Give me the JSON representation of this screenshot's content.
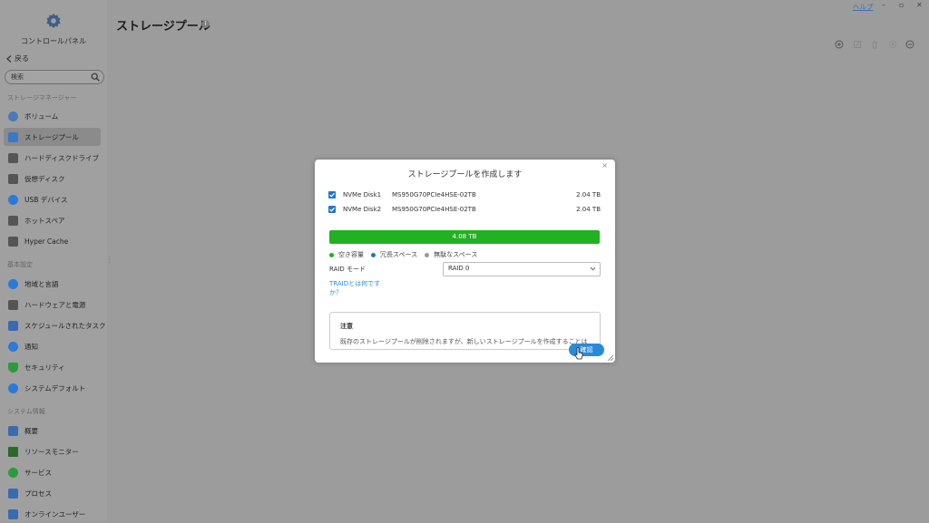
{
  "header": {
    "control_panel_label": "コントロールパネル",
    "title": "ストレージプール",
    "info_icon": "info-icon",
    "help": "ヘルプ",
    "window_controls": [
      "–",
      "▫",
      "✕"
    ]
  },
  "sidebar": {
    "back": "戻る",
    "search_placeholder": "検索",
    "sections": [
      {
        "title": "ストレージマネージャー",
        "items": [
          {
            "label": "ボリューム",
            "icon": "volume-icon",
            "color": "#4a7ab8"
          },
          {
            "label": "ストレージプール",
            "icon": "storage-pool-icon",
            "color": "#3a78c8",
            "active": true
          },
          {
            "label": "ハードディスクドライブ",
            "icon": "hdd-icon",
            "color": "#555555"
          },
          {
            "label": "仮想ディスク",
            "icon": "virtual-disk-icon",
            "color": "#555555"
          },
          {
            "label": "USB デバイス",
            "icon": "usb-icon",
            "color": "#2a7ad8"
          },
          {
            "label": "ホットスペア",
            "icon": "hot-spare-icon",
            "color": "#555555"
          },
          {
            "label": "Hyper Cache",
            "icon": "hyper-cache-icon",
            "color": "#555555"
          }
        ]
      },
      {
        "title": "基本設定",
        "items": [
          {
            "label": "地域と言語",
            "icon": "globe-icon",
            "color": "#2a7ad8"
          },
          {
            "label": "ハードウェアと電源",
            "icon": "tools-icon",
            "color": "#555555"
          },
          {
            "label": "スケジュールされたタスク",
            "icon": "schedule-icon",
            "color": "#3a6ab0"
          },
          {
            "label": "通知",
            "icon": "chat-icon",
            "color": "#2a7ad8"
          },
          {
            "label": "セキュリティ",
            "icon": "shield-icon",
            "color": "#2a9a3a"
          },
          {
            "label": "システムデフォルト",
            "icon": "reset-icon",
            "color": "#2a7ad8"
          }
        ]
      },
      {
        "title": "システム情報",
        "items": [
          {
            "label": "概要",
            "icon": "overview-icon",
            "color": "#3a6ab0"
          },
          {
            "label": "リソースモニター",
            "icon": "monitor-icon",
            "color": "#2a6a2a"
          },
          {
            "label": "サービス",
            "icon": "service-icon",
            "color": "#2a9a3a"
          },
          {
            "label": "プロセス",
            "icon": "process-icon",
            "color": "#3a6ab0"
          },
          {
            "label": "オンラインユーザー",
            "icon": "users-icon",
            "color": "#3a6ab0"
          }
        ]
      }
    ]
  },
  "toolbar": {
    "icons": [
      "add-icon",
      "edit-icon",
      "delete-icon",
      "settings-icon",
      "minus-icon"
    ]
  },
  "dialog": {
    "title": "ストレージプールを作成します",
    "disks": [
      {
        "name": "NVMe Disk1",
        "model": "MS950G70PCIe4HSE-02TB",
        "size": "2.04 TB",
        "checked": true
      },
      {
        "name": "NVMe Disk2",
        "model": "MS950G70PCIe4HSE-02TB",
        "size": "2.04 TB",
        "checked": true
      }
    ],
    "capacity_bar": {
      "label": "4.08 TB",
      "color": "#22b122"
    },
    "legend": [
      {
        "label": "空き容量",
        "color": "#22b122"
      },
      {
        "label": "冗長スペース",
        "color": "#1e78c8"
      },
      {
        "label": "無駄なスペース",
        "color": "#999999"
      }
    ],
    "raid_mode_label": "RAID モード",
    "raid_mode_value": "RAID 0",
    "traid_link": "TRAIDとは何ですか？",
    "note_title": "注意",
    "note_text": "既存のストレージプールが削除されますが、新しいストレージプールを作成することは",
    "confirm": "確認"
  }
}
